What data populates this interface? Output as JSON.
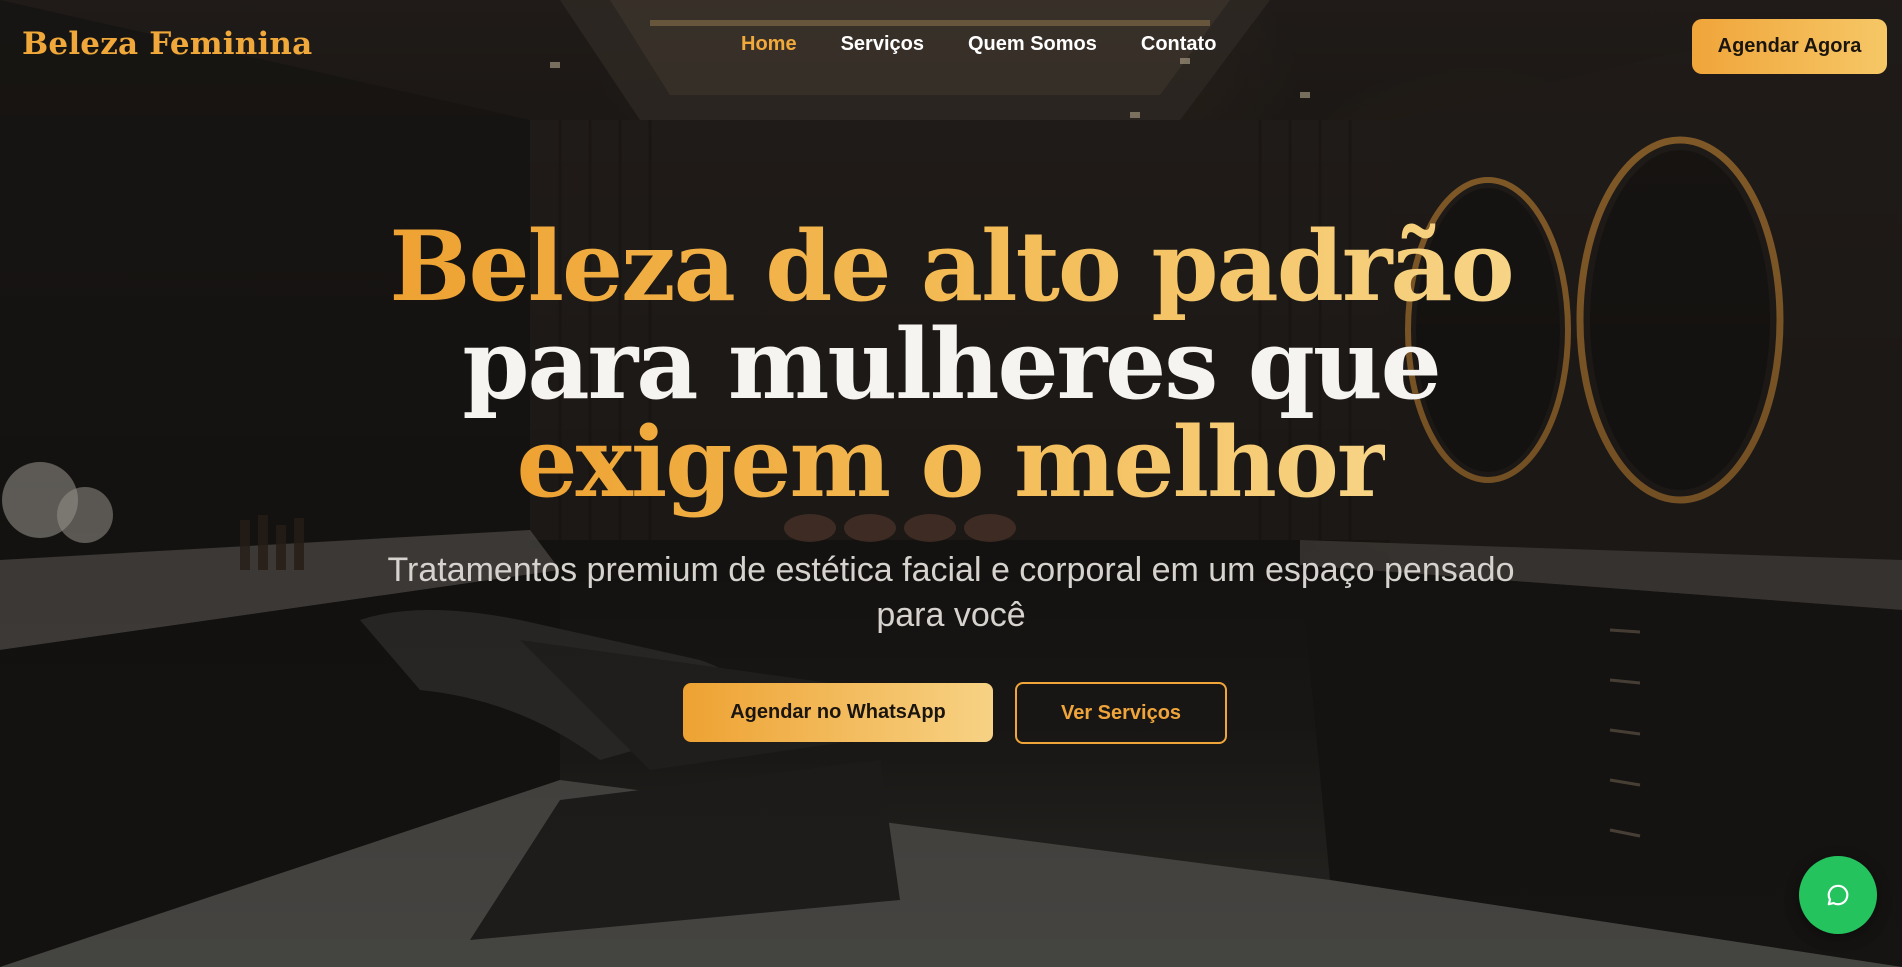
{
  "brand": {
    "name": "Beleza Feminina"
  },
  "nav": {
    "items": [
      {
        "label": "Home",
        "active": true
      },
      {
        "label": "Serviços",
        "active": false
      },
      {
        "label": "Quem Somos",
        "active": false
      },
      {
        "label": "Contato",
        "active": false
      }
    ],
    "cta_label": "Agendar Agora"
  },
  "hero": {
    "headline_line1": "Beleza de alto padrão",
    "headline_line2": "para mulheres que",
    "headline_line3": "exigem o melhor",
    "subtitle": "Tratamentos premium de estética facial e corporal em um espaço pensado para você",
    "primary_button": "Agendar no WhatsApp",
    "secondary_button": "Ver Serviços"
  },
  "floating_chat": {
    "icon": "chat-bubble-icon"
  },
  "colors": {
    "accent_gold": "#F0A53A",
    "accent_gold_light": "#F7D284",
    "whatsapp_green": "#25C35E",
    "text_white": "#F6F4F1"
  }
}
